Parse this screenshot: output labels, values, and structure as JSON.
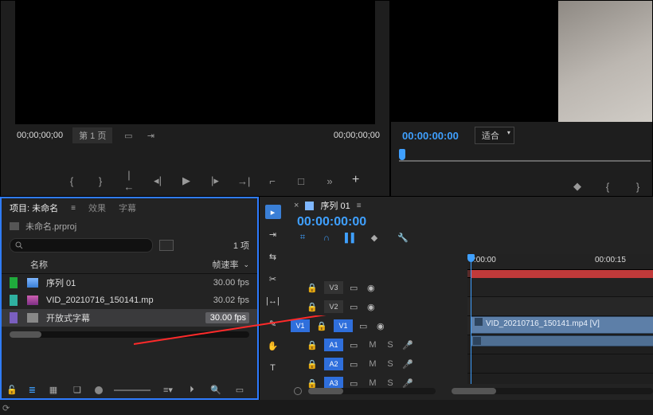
{
  "monitor_left": {
    "tc_left": "00;00;00;00",
    "page_label": "第 1 页",
    "tc_right": "00;00;00;00"
  },
  "monitor_right": {
    "tc": "00:00:00:00",
    "fit_label": "适合"
  },
  "project_panel": {
    "tab_project": "项目: 未命名",
    "tab_effects": "效果",
    "tab_captions": "字幕",
    "file_label": "未命名.prproj",
    "items_count_label": "1 项",
    "col_name": "名称",
    "col_fps": "帧速率",
    "rows": [
      {
        "name": "序列 01",
        "fps": "30.00 fps"
      },
      {
        "name": "VID_20210716_150141.mp",
        "fps": "30.02 fps"
      },
      {
        "name": "开放式字幕",
        "fps": "30.00 fps"
      }
    ]
  },
  "timeline": {
    "sequence_name": "序列 01",
    "tc": "00:00:00:00",
    "ruler_tick_0": ":00:00",
    "ruler_tick_15": "00:00:15",
    "clip_v1_label": "VID_20210716_150141.mp4 [V]",
    "tracks_v": [
      "V3",
      "V2",
      "V1"
    ],
    "tracks_a": [
      "A1",
      "A2",
      "A3"
    ],
    "ms_m": "M",
    "ms_s": "S"
  }
}
